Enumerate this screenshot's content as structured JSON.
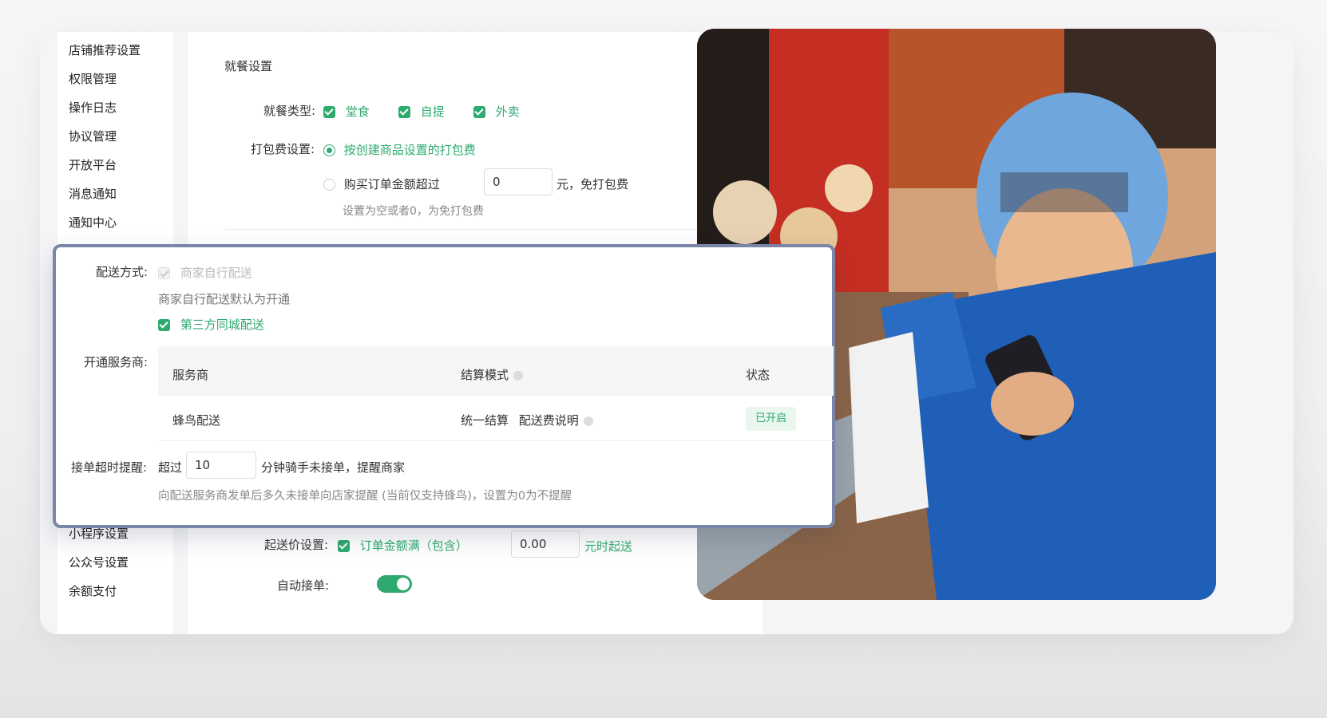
{
  "sidebar": {
    "items": [
      "店铺推荐设置",
      "权限管理",
      "操作日志",
      "协议管理",
      "开放平台",
      "消息通知",
      "通知中心"
    ],
    "bottom_items": [
      "小程序设置",
      "公众号设置",
      "余额支付"
    ]
  },
  "dining": {
    "section_title": "就餐设置",
    "type_label": "就餐类型:",
    "types": [
      "堂食",
      "自提",
      "外卖"
    ],
    "packing_label": "打包费设置:",
    "packing_option1": "按创建商品设置的打包费",
    "packing_option2_prefix": "购买订单金额超过",
    "packing_amount": "0",
    "packing_option2_suffix": "元，免打包费",
    "packing_hint": "设置为空或者0，为免打包费"
  },
  "delivery": {
    "method_label": "配送方式:",
    "self_delivery": "商家自行配送",
    "self_delivery_hint": "商家自行配送默认为开通",
    "third_party": "第三方同城配送",
    "provider_label": "开通服务商:",
    "table_headers": [
      "服务商",
      "结算模式",
      "状态"
    ],
    "rows": [
      {
        "provider": "蜂鸟配送",
        "mode": "统一结算",
        "fee_note": "配送费说明",
        "status": "已开启"
      }
    ],
    "timeout_label": "接单超时提醒:",
    "timeout_prefix": "超过",
    "timeout_value": "10",
    "timeout_suffix": "分钟骑手未接单，提醒商家",
    "timeout_hint": "向配送服务商发单后多久未接单向店家提醒 (当前仅支持蜂鸟)，设置为0为不提醒"
  },
  "min_order": {
    "label": "起送价设置:",
    "option": "订单金额满（包含）",
    "value": "0.00",
    "suffix": "元时起送"
  },
  "auto_accept": {
    "label": "自动接单:",
    "enabled": true
  },
  "colors": {
    "accent": "#2faa6f",
    "popup_border": "#7a86a8"
  }
}
